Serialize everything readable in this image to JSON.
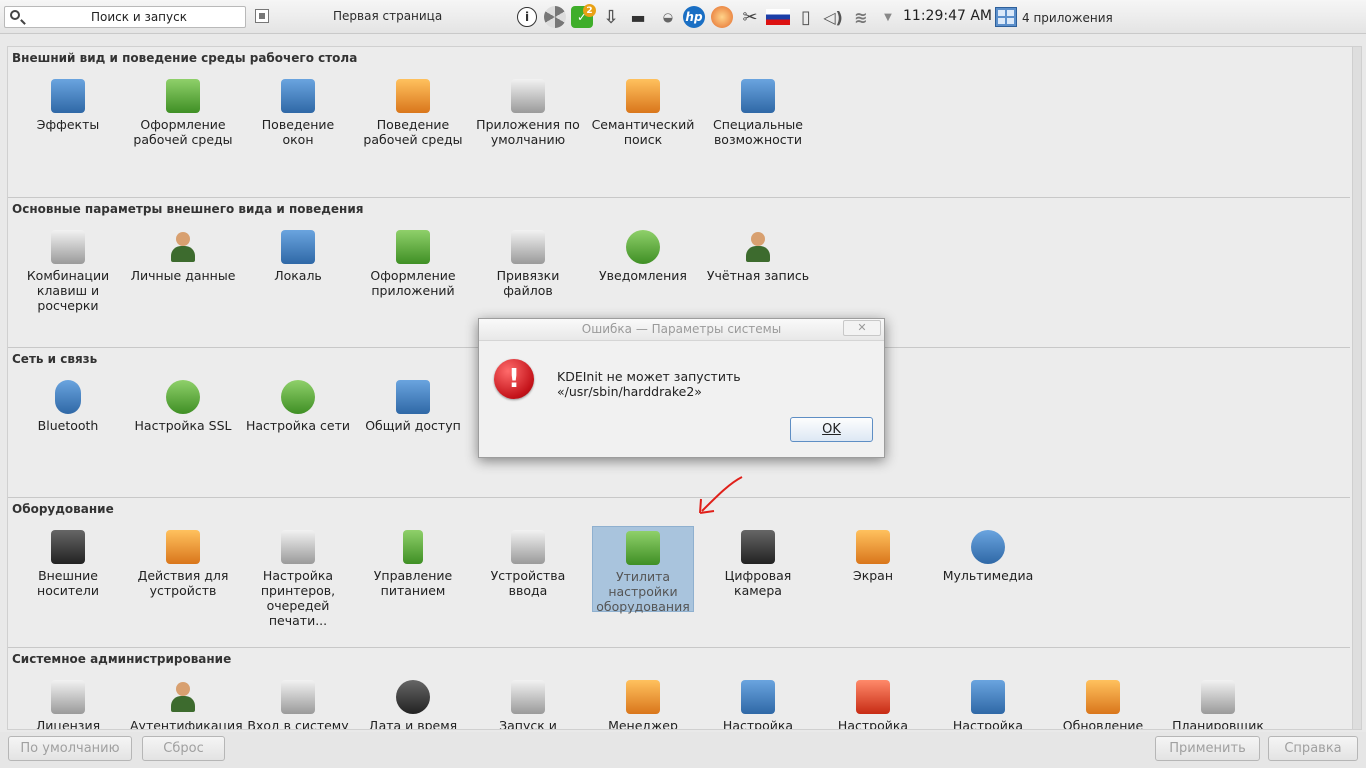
{
  "panel": {
    "search_label": "Поиск и запуск",
    "page_name": "Первая страница",
    "clock": "11:29:47 AM",
    "apps_label": "4 приложения",
    "update_badge": "2",
    "tray_icons": [
      "info-icon",
      "aperture-icon",
      "update-icon",
      "download-icon",
      "tray-app-icon",
      "hp-icon",
      "lightbulb-icon",
      "scissors-icon",
      "flag-ru-icon",
      "clipboard-icon",
      "volume-icon",
      "wifi-icon",
      "chevron-down-icon"
    ]
  },
  "sections": [
    {
      "title": "Внешний вид и поведение среды рабочего стола",
      "items": [
        {
          "label": "Эффекты",
          "icon": "effects-icon"
        },
        {
          "label": "Оформление рабочей среды",
          "icon": "workspace-theme-icon"
        },
        {
          "label": "Поведение окон",
          "icon": "window-behavior-icon"
        },
        {
          "label": "Поведение рабочей среды",
          "icon": "workspace-behavior-icon"
        },
        {
          "label": "Приложения по умолчанию",
          "icon": "default-apps-icon"
        },
        {
          "label": "Семантический поиск",
          "icon": "semantic-search-icon"
        },
        {
          "label": "Специальные возможности",
          "icon": "accessibility-icon"
        }
      ]
    },
    {
      "title": "Основные параметры внешнего вида и поведения",
      "items": [
        {
          "label": "Комбинации клавиш и росчерки",
          "icon": "shortcuts-icon"
        },
        {
          "label": "Личные данные",
          "icon": "personal-info-icon"
        },
        {
          "label": "Локаль",
          "icon": "locale-icon"
        },
        {
          "label": "Оформление приложений",
          "icon": "app-theme-icon"
        },
        {
          "label": "Привязки файлов",
          "icon": "file-associations-icon"
        },
        {
          "label": "Уведомления",
          "icon": "notifications-icon"
        },
        {
          "label": "Учётная запись",
          "icon": "account-icon"
        }
      ]
    },
    {
      "title": "Сеть и связь",
      "items": [
        {
          "label": "Bluetooth",
          "icon": "bluetooth-icon"
        },
        {
          "label": "Настройка SSL",
          "icon": "ssl-icon"
        },
        {
          "label": "Настройка сети",
          "icon": "network-icon"
        },
        {
          "label": "Общий доступ",
          "icon": "sharing-icon"
        }
      ]
    },
    {
      "title": "Оборудование",
      "items": [
        {
          "label": "Внешние носители",
          "icon": "removable-media-icon"
        },
        {
          "label": "Действия для устройств",
          "icon": "device-actions-icon"
        },
        {
          "label": "Настройка принтеров, очередей печати...",
          "icon": "printer-icon"
        },
        {
          "label": "Управление питанием",
          "icon": "battery-icon"
        },
        {
          "label": "Устройства ввода",
          "icon": "keyboard-icon"
        },
        {
          "label": "Утилита настройки оборудования",
          "icon": "hardware-tool-icon",
          "selected": true
        },
        {
          "label": "Цифровая камера",
          "icon": "camera-icon"
        },
        {
          "label": "Экран",
          "icon": "display-icon"
        },
        {
          "label": "Мультимедиа",
          "icon": "multimedia-icon"
        }
      ]
    },
    {
      "title": "Системное администрирование",
      "items": [
        {
          "label": "Лицензия",
          "icon": "license-icon"
        },
        {
          "label": "Аутентификация",
          "icon": "authentication-icon"
        },
        {
          "label": "Вход в систему",
          "icon": "login-icon"
        },
        {
          "label": "Дата и время",
          "icon": "clock-icon"
        },
        {
          "label": "Запуск и",
          "icon": "startup-icon"
        },
        {
          "label": "Менеджер",
          "icon": "package-manager-icon"
        },
        {
          "label": "Настройка",
          "icon": "config1-icon"
        },
        {
          "label": "Настройка",
          "icon": "config2-icon"
        },
        {
          "label": "Настройка",
          "icon": "config3-icon"
        },
        {
          "label": "Обновление",
          "icon": "update-system-icon"
        },
        {
          "label": "Планировщик",
          "icon": "scheduler-icon"
        }
      ]
    }
  ],
  "bottom": {
    "defaults": "По умолчанию",
    "reset": "Сброс",
    "apply": "Применить",
    "help": "Справка"
  },
  "dialog": {
    "title": "Ошибка — Параметры системы",
    "message": "KDEInit не может запустить «/usr/sbin/harddrake2»",
    "ok": "OK",
    "close": "✕"
  },
  "colors": {
    "selection": "#a9c4dd",
    "error_icon": "#c4131a",
    "annotation_arrow": "#e0201a"
  }
}
